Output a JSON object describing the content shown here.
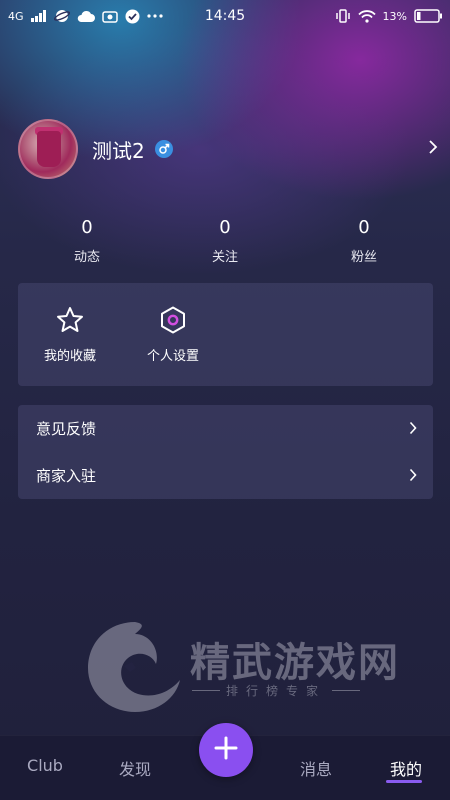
{
  "status_bar": {
    "network": "4G",
    "time": "14:45",
    "battery": "13%"
  },
  "profile": {
    "username": "测试2",
    "gender_icon": "male-icon"
  },
  "stats": [
    {
      "value": "0",
      "label": "动态"
    },
    {
      "value": "0",
      "label": "关注"
    },
    {
      "value": "0",
      "label": "粉丝"
    }
  ],
  "shortcuts": [
    {
      "label": "我的收藏",
      "icon": "star-icon"
    },
    {
      "label": "个人设置",
      "icon": "hexagon-settings-icon"
    }
  ],
  "menu": [
    {
      "label": "意见反馈"
    },
    {
      "label": "商家入驻"
    }
  ],
  "watermark": {
    "title": "精武游戏网",
    "subtitle": "排行榜专家"
  },
  "tabbar": {
    "tabs": [
      {
        "label": "Club"
      },
      {
        "label": "发现"
      },
      {
        "label": "消息"
      },
      {
        "label": "我的"
      }
    ],
    "active_index": 3,
    "add_icon": "plus-icon"
  },
  "colors": {
    "accent": "#8a4ff0",
    "background": "#232341",
    "card": "#46466e"
  }
}
